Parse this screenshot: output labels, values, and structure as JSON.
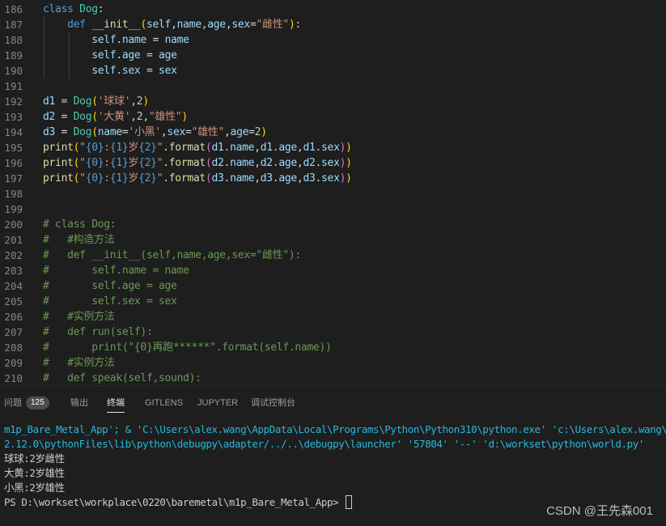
{
  "editor": {
    "lines": [
      {
        "n": "186",
        "t": [
          [
            "kw",
            "class "
          ],
          [
            "cls",
            "Dog"
          ],
          [
            "op",
            ":"
          ]
        ]
      },
      {
        "n": "187",
        "t": [
          [
            "op",
            "    "
          ],
          [
            "kw",
            "def "
          ],
          [
            "fn",
            "__init__"
          ],
          [
            "b1",
            "("
          ],
          [
            "var",
            "self"
          ],
          [
            "op",
            ","
          ],
          [
            "var",
            "name"
          ],
          [
            "op",
            ","
          ],
          [
            "var",
            "age"
          ],
          [
            "op",
            ","
          ],
          [
            "var",
            "sex"
          ],
          [
            "op",
            "="
          ],
          [
            "str",
            "\"雌性\""
          ],
          [
            "b1",
            ")"
          ],
          [
            "op",
            ":"
          ]
        ]
      },
      {
        "n": "188",
        "t": [
          [
            "op",
            "        "
          ],
          [
            "var",
            "self"
          ],
          [
            "op",
            "."
          ],
          [
            "var",
            "name"
          ],
          [
            "op",
            " = "
          ],
          [
            "var",
            "name"
          ]
        ]
      },
      {
        "n": "189",
        "t": [
          [
            "op",
            "        "
          ],
          [
            "var",
            "self"
          ],
          [
            "op",
            "."
          ],
          [
            "var",
            "age"
          ],
          [
            "op",
            " = "
          ],
          [
            "var",
            "age"
          ]
        ]
      },
      {
        "n": "190",
        "t": [
          [
            "op",
            "        "
          ],
          [
            "var",
            "self"
          ],
          [
            "op",
            "."
          ],
          [
            "var",
            "sex"
          ],
          [
            "op",
            " = "
          ],
          [
            "var",
            "sex"
          ]
        ]
      },
      {
        "n": "191",
        "t": []
      },
      {
        "n": "192",
        "t": [
          [
            "var",
            "d1"
          ],
          [
            "op",
            " = "
          ],
          [
            "cls",
            "Dog"
          ],
          [
            "b1",
            "("
          ],
          [
            "str",
            "'球球'"
          ],
          [
            "op",
            ","
          ],
          [
            "num",
            "2"
          ],
          [
            "b1",
            ")"
          ]
        ]
      },
      {
        "n": "193",
        "t": [
          [
            "var",
            "d2"
          ],
          [
            "op",
            " = "
          ],
          [
            "cls",
            "Dog"
          ],
          [
            "b1",
            "("
          ],
          [
            "str",
            "'大黄'"
          ],
          [
            "op",
            ","
          ],
          [
            "num",
            "2"
          ],
          [
            "op",
            ","
          ],
          [
            "str",
            "\"雄性\""
          ],
          [
            "b1",
            ")"
          ]
        ]
      },
      {
        "n": "194",
        "t": [
          [
            "var",
            "d3"
          ],
          [
            "op",
            " = "
          ],
          [
            "cls",
            "Dog"
          ],
          [
            "b1",
            "("
          ],
          [
            "var",
            "name"
          ],
          [
            "op",
            "="
          ],
          [
            "str",
            "'小黑'"
          ],
          [
            "op",
            ","
          ],
          [
            "var",
            "sex"
          ],
          [
            "op",
            "="
          ],
          [
            "str",
            "\"雄性\""
          ],
          [
            "op",
            ","
          ],
          [
            "var",
            "age"
          ],
          [
            "op",
            "="
          ],
          [
            "num",
            "2"
          ],
          [
            "b1",
            ")"
          ]
        ]
      },
      {
        "n": "195",
        "t": [
          [
            "fn",
            "print"
          ],
          [
            "b1",
            "("
          ],
          [
            "str",
            "\""
          ],
          [
            "kw",
            "{0}"
          ],
          [
            "str",
            ":"
          ],
          [
            "kw",
            "{1}"
          ],
          [
            "str",
            "岁"
          ],
          [
            "kw",
            "{2}"
          ],
          [
            "str",
            "\""
          ],
          [
            "op",
            "."
          ],
          [
            "fn",
            "format"
          ],
          [
            "b2",
            "("
          ],
          [
            "var",
            "d1"
          ],
          [
            "op",
            "."
          ],
          [
            "var",
            "name"
          ],
          [
            "op",
            ","
          ],
          [
            "var",
            "d1"
          ],
          [
            "op",
            "."
          ],
          [
            "var",
            "age"
          ],
          [
            "op",
            ","
          ],
          [
            "var",
            "d1"
          ],
          [
            "op",
            "."
          ],
          [
            "var",
            "sex"
          ],
          [
            "b2",
            ")"
          ],
          [
            "b1",
            ")"
          ]
        ]
      },
      {
        "n": "196",
        "t": [
          [
            "fn",
            "print"
          ],
          [
            "b1",
            "("
          ],
          [
            "str",
            "\""
          ],
          [
            "kw",
            "{0}"
          ],
          [
            "str",
            ":"
          ],
          [
            "kw",
            "{1}"
          ],
          [
            "str",
            "岁"
          ],
          [
            "kw",
            "{2}"
          ],
          [
            "str",
            "\""
          ],
          [
            "op",
            "."
          ],
          [
            "fn",
            "format"
          ],
          [
            "b2",
            "("
          ],
          [
            "var",
            "d2"
          ],
          [
            "op",
            "."
          ],
          [
            "var",
            "name"
          ],
          [
            "op",
            ","
          ],
          [
            "var",
            "d2"
          ],
          [
            "op",
            "."
          ],
          [
            "var",
            "age"
          ],
          [
            "op",
            ","
          ],
          [
            "var",
            "d2"
          ],
          [
            "op",
            "."
          ],
          [
            "var",
            "sex"
          ],
          [
            "b2",
            ")"
          ],
          [
            "b1",
            ")"
          ]
        ]
      },
      {
        "n": "197",
        "t": [
          [
            "fn",
            "print"
          ],
          [
            "b1",
            "("
          ],
          [
            "str",
            "\""
          ],
          [
            "kw",
            "{0}"
          ],
          [
            "str",
            ":"
          ],
          [
            "kw",
            "{1}"
          ],
          [
            "str",
            "岁"
          ],
          [
            "kw",
            "{2}"
          ],
          [
            "str",
            "\""
          ],
          [
            "op",
            "."
          ],
          [
            "fn",
            "format"
          ],
          [
            "b2",
            "("
          ],
          [
            "var",
            "d3"
          ],
          [
            "op",
            "."
          ],
          [
            "var",
            "name"
          ],
          [
            "op",
            ","
          ],
          [
            "var",
            "d3"
          ],
          [
            "op",
            "."
          ],
          [
            "var",
            "age"
          ],
          [
            "op",
            ","
          ],
          [
            "var",
            "d3"
          ],
          [
            "op",
            "."
          ],
          [
            "var",
            "sex"
          ],
          [
            "b2",
            ")"
          ],
          [
            "b1",
            ")"
          ]
        ]
      },
      {
        "n": "198",
        "t": []
      },
      {
        "n": "199",
        "t": []
      },
      {
        "n": "200",
        "t": [
          [
            "cmt",
            "# class Dog:"
          ]
        ]
      },
      {
        "n": "201",
        "t": [
          [
            "cmt",
            "#   #构造方法"
          ]
        ]
      },
      {
        "n": "202",
        "t": [
          [
            "cmt",
            "#   def __init__(self,name,age,sex=\"雌性\"):"
          ]
        ]
      },
      {
        "n": "203",
        "t": [
          [
            "cmt",
            "#       self.name = name"
          ]
        ]
      },
      {
        "n": "204",
        "t": [
          [
            "cmt",
            "#       self.age = age"
          ]
        ]
      },
      {
        "n": "205",
        "t": [
          [
            "cmt",
            "#       self.sex = sex"
          ]
        ]
      },
      {
        "n": "206",
        "t": [
          [
            "cmt",
            "#   #实例方法"
          ]
        ]
      },
      {
        "n": "207",
        "t": [
          [
            "cmt",
            "#   def run(self):"
          ]
        ]
      },
      {
        "n": "208",
        "t": [
          [
            "cmt",
            "#       print(\"{0}再跑******\".format(self.name))"
          ]
        ]
      },
      {
        "n": "209",
        "t": [
          [
            "cmt",
            "#   #实例方法"
          ]
        ]
      },
      {
        "n": "210",
        "t": [
          [
            "cmt",
            "#   def speak(self,sound):"
          ]
        ]
      }
    ]
  },
  "panel": {
    "tabs": [
      {
        "label": "问题",
        "badge": "125",
        "active": false,
        "name": "tab-problems"
      },
      {
        "label": "输出",
        "active": false,
        "name": "tab-output"
      },
      {
        "label": "终端",
        "active": true,
        "name": "tab-terminal"
      },
      {
        "label": "GITLENS",
        "active": false,
        "name": "tab-gitlens"
      },
      {
        "label": "JUPYTER",
        "active": false,
        "name": "tab-jupyter"
      },
      {
        "label": "调试控制台",
        "active": false,
        "name": "tab-debug-console"
      }
    ]
  },
  "terminal": {
    "lines": [
      {
        "text": "m1p_Bare_Metal_App'; & 'C:\\Users\\alex.wang\\AppData\\Local\\Programs\\Python\\Python310\\python.exe' 'c:\\Users\\alex.wang\\.v",
        "color": "cyan"
      },
      {
        "text": "2.12.0\\pythonFiles\\lib\\python\\debugpy\\adapter/../..\\debugpy\\launcher' '57804' '--' 'd:\\workset\\python\\world.py'",
        "color": "cyan"
      },
      {
        "text": "球球:2岁雌性",
        "color": "white"
      },
      {
        "text": "大黄:2岁雄性",
        "color": "white"
      },
      {
        "text": "小黑:2岁雄性",
        "color": "white"
      },
      {
        "text": "PS D:\\workset\\workplace\\0220\\baremetal\\m1p_Bare_Metal_App> ",
        "color": "white",
        "prompt": true
      }
    ]
  },
  "watermark": "CSDN @王先森001"
}
